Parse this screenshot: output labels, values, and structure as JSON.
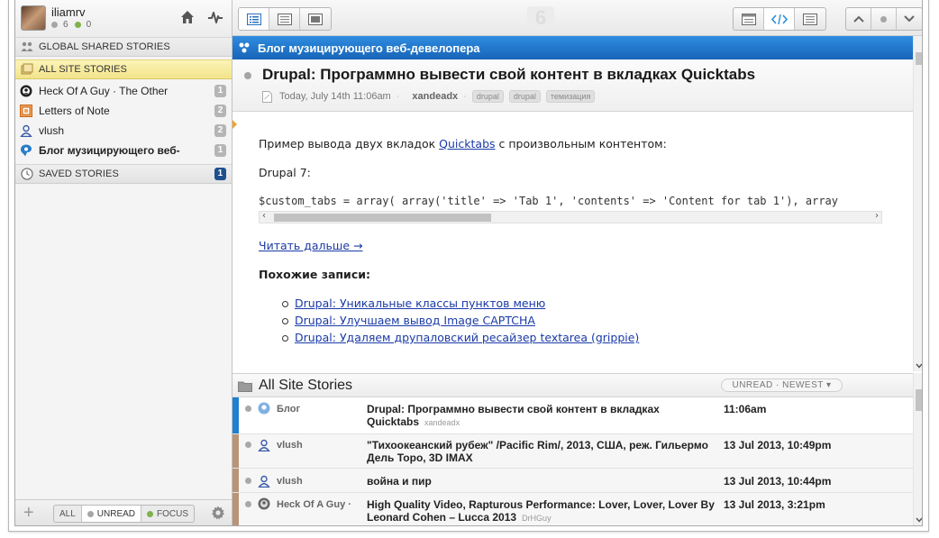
{
  "user": {
    "name": "iliamrv",
    "count_grey": "6",
    "count_green": "0"
  },
  "sidebar": {
    "global_label": "GLOBAL SHARED STORIES",
    "all_label": "ALL SITE STORIES",
    "feeds": [
      {
        "name": "Heck Of A Guy · The Other",
        "count": "1",
        "color": "#333333"
      },
      {
        "name": "Letters of Note",
        "count": "2",
        "color": "#e07a2a"
      },
      {
        "name": "vlush",
        "count": "2",
        "color": "#222222"
      },
      {
        "name": "Блог музицирующего веб-",
        "count": "1",
        "color": "#2a7cc8"
      }
    ],
    "saved_label": "SAVED STORIES",
    "saved_count": "1"
  },
  "footer": {
    "all": "ALL",
    "unread": "UNREAD",
    "focus": "FOCUS"
  },
  "toolbar": {
    "unread_count": "6"
  },
  "feed_header": {
    "title": "Блог музицирующего веб-девелопера"
  },
  "story": {
    "title": "Drupal: Программно вывести свой контент в вкладках Quicktabs",
    "date": "Today, July 14th 11:06am",
    "author": "xandeadx",
    "tags": [
      "drupal",
      "drupal",
      "темизация"
    ],
    "intro_before": "Пример вывода двух вкладок ",
    "intro_link": "Quicktabs",
    "intro_after": " с произвольным контентом:",
    "drupal_version": "Drupal 7:",
    "code": "$custom_tabs = array( array('title' => 'Tab 1', 'contents' => 'Content for tab 1'), array",
    "read_more": "Читать дальше →",
    "related_heading": "Похожие записи:",
    "related": [
      "Drupal: Уникальные классы пунктов меню",
      "Drupal: Улучшаем вывод Image CAPTCHA",
      "Drupal: Удаляем друпаловский ресайзер textarea (grippie)"
    ]
  },
  "story_list": {
    "title": "All Site Stories",
    "sort_label": "UNREAD · NEWEST ▾",
    "rows": [
      {
        "feed": "Блог",
        "title": "Drupal: Программно вывести свой контент в вкладках Quicktabs",
        "author": "xandeadx",
        "date": "11:06am",
        "stripe": "#1f7fd0"
      },
      {
        "feed": "vlush",
        "title": "\"Тихоокеанский рубеж\" /Pacific Rim/, 2013, США, реж. Гильермо Дель Торо, 3D IMAX",
        "author": "",
        "date": "13 Jul 2013, 10:49pm",
        "stripe": "#b89478"
      },
      {
        "feed": "vlush",
        "title": "война и пир",
        "author": "",
        "date": "13 Jul 2013, 10:44pm",
        "stripe": "#b89478"
      },
      {
        "feed": "Heck Of A Guy ·",
        "title": "High Quality Video, Rapturous Performance: Lover, Lover, Lover By Leonard Cohen – Lucca 2013",
        "author": "DrHGuy",
        "date": "13 Jul 2013, 3:21pm",
        "stripe": "#b89478"
      }
    ]
  }
}
